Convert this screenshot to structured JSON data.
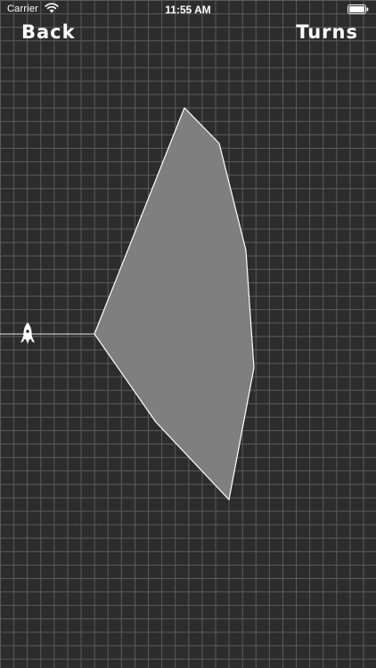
{
  "status_bar": {
    "carrier": "Carrier",
    "time": "11:55 AM",
    "wifi_icon": "wifi-icon",
    "battery_icon": "battery-icon"
  },
  "nav": {
    "back_label": "Back",
    "turns_label": "Turns"
  },
  "game": {
    "background_color": "#2c2c2c",
    "grid_color": "#5c5c5c",
    "planet_fill": "#7f7f7f",
    "planet_stroke": "#ffffff",
    "trail_color": "#e6e6e6",
    "ship_icon": "rocket-icon"
  }
}
